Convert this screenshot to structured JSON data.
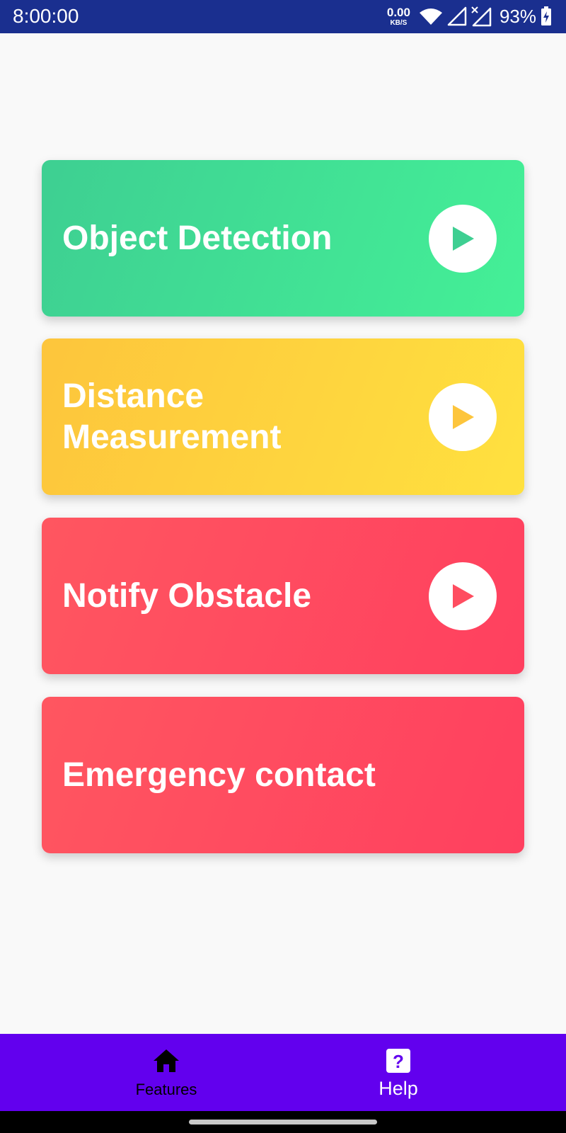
{
  "status_bar": {
    "time": "8:00:00",
    "net_speed": "0.00",
    "net_speed_unit": "KB/S",
    "battery_percent": "93%"
  },
  "cards": [
    {
      "title": "Object Detection",
      "color": "#3ecf92",
      "play_icon": "play-icon"
    },
    {
      "title": "Distance Measurement",
      "color": "#fdc53c",
      "play_icon": "play-icon"
    },
    {
      "title": "Notify Obstacle",
      "color": "#ff4d60",
      "play_icon": "play-icon"
    },
    {
      "title": "Emergency contact",
      "color": "#ff4d60"
    }
  ],
  "bottom_nav": {
    "background": "#6200ee",
    "items": [
      {
        "label": "Features",
        "icon": "home-icon",
        "selected": true
      },
      {
        "label": "Help",
        "icon": "help-icon",
        "selected": false
      }
    ]
  }
}
